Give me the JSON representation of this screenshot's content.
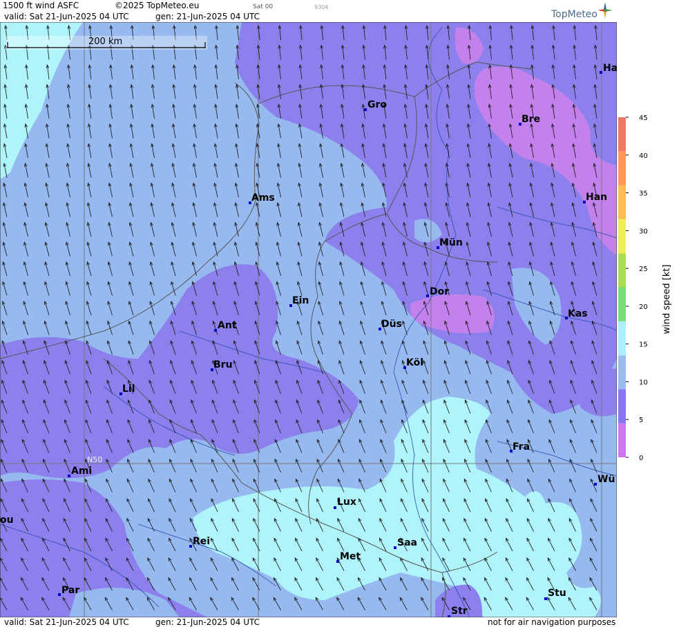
{
  "header": {
    "product": "1500 ft wind ASFC",
    "copyright": "©2025 TopMeteo.eu",
    "run_code": "Sat 00",
    "id_code": "9304",
    "valid": "valid:  Sat  21-Jun-2025  04 UTC",
    "generated": "gen:  21-Jun-2025 04 UTC",
    "brand": "TopMeteo"
  },
  "footer": {
    "valid": "valid:  Sat  21-Jun-2025  04 UTC",
    "generated": "gen:  21-Jun-2025 04 UTC",
    "disclaimer": "not for air navigation purposes"
  },
  "map": {
    "scale_label": "200 km",
    "lat_label": "N50",
    "cities": [
      {
        "name": "Ha"
      },
      {
        "name": "Gro"
      },
      {
        "name": "Bre"
      },
      {
        "name": "Ams"
      },
      {
        "name": "Han"
      },
      {
        "name": "Mün"
      },
      {
        "name": "Ein"
      },
      {
        "name": "Dor"
      },
      {
        "name": "Ant"
      },
      {
        "name": "Düs"
      },
      {
        "name": "Kas"
      },
      {
        "name": "Bru"
      },
      {
        "name": "Köl"
      },
      {
        "name": "Lil"
      },
      {
        "name": "Fra"
      },
      {
        "name": "Ami"
      },
      {
        "name": "Wü"
      },
      {
        "name": "Lux"
      },
      {
        "name": "ou"
      },
      {
        "name": "Rei"
      },
      {
        "name": "Saa"
      },
      {
        "name": "Met"
      },
      {
        "name": "Par"
      },
      {
        "name": "Stu"
      },
      {
        "name": "Str"
      }
    ]
  },
  "legend": {
    "title": "wind speed  [kt]",
    "ticks": [
      "0",
      "5",
      "10",
      "15",
      "20",
      "25",
      "30",
      "35",
      "40",
      "45"
    ],
    "colors": [
      "#cc77ee",
      "#8877ee",
      "#99bbee",
      "#aaeeff",
      "#77dd77",
      "#aadd55",
      "#eeee55",
      "#ffbb55",
      "#ff9955",
      "#ee7766"
    ]
  },
  "colors": {
    "calm": "#c381ec",
    "light": "#8c80ec",
    "moderate": "#96b9ef",
    "fresh": "#aff4fb"
  }
}
